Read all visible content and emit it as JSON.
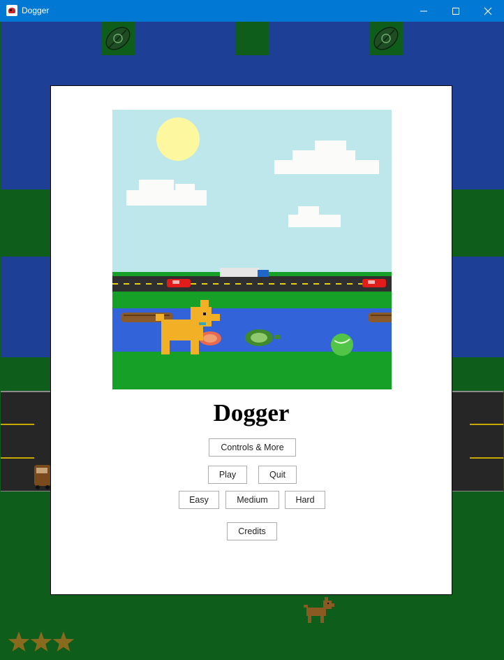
{
  "window": {
    "title": "Dogger",
    "controls": [
      "minimize",
      "maximize",
      "close"
    ]
  },
  "menu": {
    "title": "Dogger",
    "buttons": {
      "controls": "Controls & More",
      "play": "Play",
      "quit": "Quit",
      "easy": "Easy",
      "medium": "Medium",
      "hard": "Hard",
      "credits": "Credits"
    }
  },
  "hud": {
    "stars": 3,
    "star_color": "#8a6a1c"
  },
  "colors": {
    "titlebar": "#0078d4",
    "water": "#1d3f95",
    "grass": "#0f5d1b",
    "road": "#262626",
    "road_line": "#c8a800",
    "sky": "#bde7ea"
  },
  "icons": [
    "app-icon",
    "minimize-icon",
    "maximize-icon",
    "close-icon",
    "lily-pad-icon",
    "star-icon",
    "dog-icon",
    "sun-icon",
    "cloud-icon",
    "car-icon",
    "truck-icon",
    "log-icon",
    "turtle-icon",
    "tennis-ball-icon"
  ]
}
